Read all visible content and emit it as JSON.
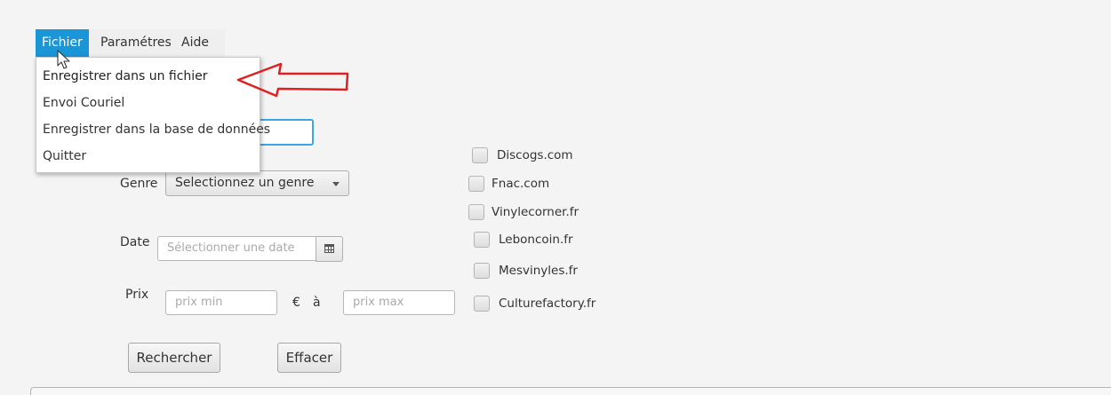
{
  "menubar": {
    "items": [
      {
        "label": "Fichier",
        "active": true
      },
      {
        "label": "Paramétres"
      },
      {
        "label": "Aide"
      }
    ]
  },
  "file_menu": {
    "items": [
      {
        "label": "Enregistrer dans un fichier"
      },
      {
        "label": "Envoi Couriel"
      },
      {
        "label": "Enregistrer dans la base de données"
      },
      {
        "label": "Quitter"
      }
    ]
  },
  "form": {
    "genre_label": "Genre",
    "genre_select": {
      "value": "Selectionnez un genre"
    },
    "date_label": "Date",
    "date_placeholder": "Sélectionner une date",
    "prix_label": "Prix",
    "prix_min_placeholder": "prix min",
    "currency": "€",
    "a_label": "à",
    "prix_max_placeholder": "prix max",
    "search_button": "Rechercher",
    "clear_button": "Effacer"
  },
  "sites": [
    {
      "label": "Discogs.com",
      "checked": false
    },
    {
      "label": "Fnac.com",
      "checked": false
    },
    {
      "label": "Vinylecorner.fr",
      "checked": false
    },
    {
      "label": "Leboncoin.fr",
      "checked": false
    },
    {
      "label": "Mesvinyles.fr",
      "checked": false
    },
    {
      "label": "Culturefactory.fr",
      "checked": false
    }
  ],
  "colors": {
    "menu_active": "#1a95d6",
    "focus_border": "#3aa6e4",
    "annotation_arrow": "#e02020"
  },
  "icons": [
    "calendar-icon",
    "chevron-down-icon",
    "mouse-cursor-icon",
    "red-arrow-icon"
  ]
}
